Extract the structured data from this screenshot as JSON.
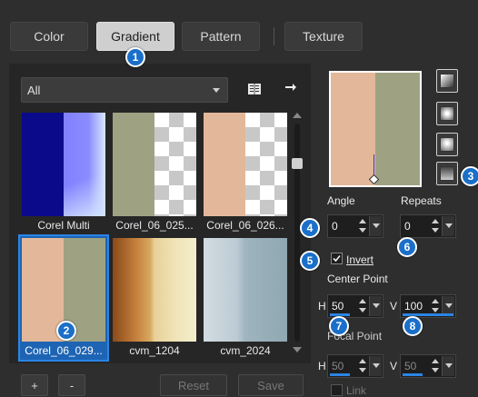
{
  "tabs": [
    {
      "label": "Color",
      "active": false
    },
    {
      "label": "Gradient",
      "active": true
    },
    {
      "label": "Pattern",
      "active": false
    },
    {
      "label": "Texture",
      "active": false
    }
  ],
  "callouts": [
    "1",
    "2",
    "3",
    "4",
    "5",
    "6",
    "7",
    "8"
  ],
  "category_dropdown": {
    "value": "All"
  },
  "gradients": [
    {
      "label": "Corel Multi",
      "selected": false
    },
    {
      "label": "Corel_06_025...",
      "selected": false
    },
    {
      "label": "Corel_06_026...",
      "selected": false
    },
    {
      "label": "Corel_06_029...",
      "selected": true
    },
    {
      "label": "cvm_1204",
      "selected": false
    },
    {
      "label": "cvm_2024",
      "selected": false
    }
  ],
  "bottom_buttons": {
    "add": "+",
    "remove": "-",
    "reset": "Reset",
    "save": "Save"
  },
  "angle": {
    "label": "Angle",
    "value": "0"
  },
  "repeats": {
    "label": "Repeats",
    "value": "0"
  },
  "invert": {
    "label": "Invert",
    "checked": true
  },
  "center_point": {
    "label": "Center Point",
    "h_label": "H",
    "h_value": "50",
    "v_label": "V",
    "v_value": "100"
  },
  "focal_point": {
    "label": "Focal Point",
    "h_label": "H",
    "h_value": "50",
    "v_label": "V",
    "v_value": "50"
  },
  "link": {
    "label": "Link"
  },
  "colors": {
    "accent": "#1a6fc9",
    "peach": "#e3b89a",
    "sage": "#9ea282",
    "navy": "#0a0a8a",
    "periwinkle": "#8080ff"
  }
}
